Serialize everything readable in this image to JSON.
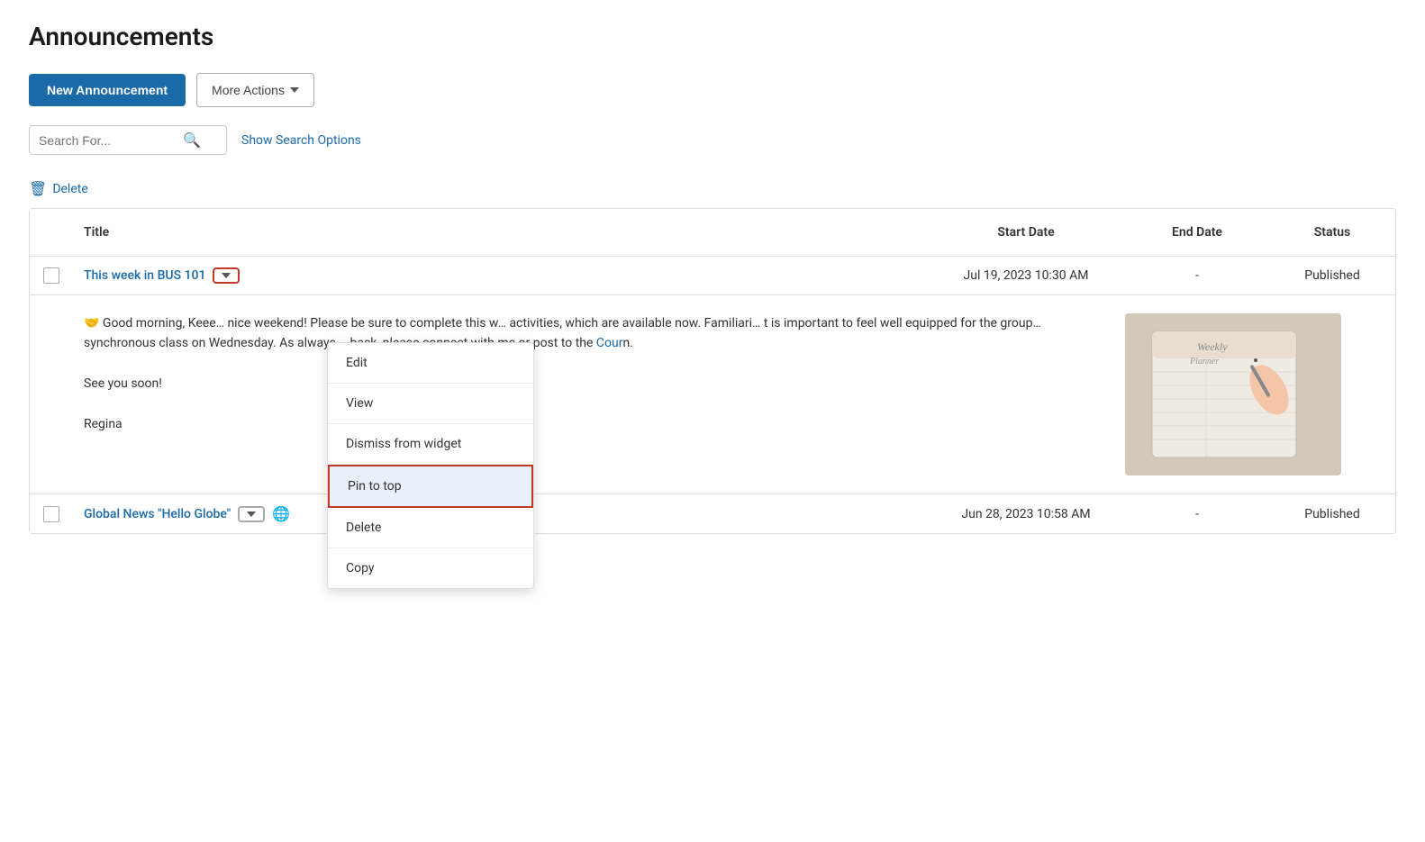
{
  "page": {
    "title": "Announcements"
  },
  "toolbar": {
    "new_announcement_label": "New Announcement",
    "more_actions_label": "More Actions"
  },
  "search": {
    "placeholder": "Search For...",
    "show_options_label": "Show Search Options"
  },
  "actions_row": {
    "delete_label": "Delete"
  },
  "table": {
    "headers": {
      "title": "Title",
      "start_date": "Start Date",
      "end_date": "End Date",
      "status": "Status"
    },
    "rows": [
      {
        "id": "row1",
        "title": "This week in BUS 101",
        "start_date": "Jul 19, 2023 10:30 AM",
        "end_date": "-",
        "status": "Published",
        "has_dropdown": true,
        "preview": {
          "text_part1": "🤝 Good morning, Kee",
          "text_part2": "nice weekend! Please be sure to complete this w",
          "text_part3": " activities, which are available now. Familiari",
          "text_part4": "t is important to feel well equipped for the group",
          "text_part5": " synchronous class on Wednesday. As always,",
          "text_part6": " back, please connect with me or post to the Cour",
          "text_part7": "n.",
          "text_see_you": "See you soon!",
          "text_name": "Regina",
          "blue_link_text": "Cour"
        }
      },
      {
        "id": "row2",
        "title": "Global News \"Hello Globe\"",
        "start_date": "Jun 28, 2023 10:58 AM",
        "end_date": "-",
        "status": "Published",
        "has_dropdown": true,
        "has_globe": true
      }
    ]
  },
  "dropdown_menu": {
    "items": [
      {
        "id": "edit",
        "label": "Edit",
        "highlighted": false
      },
      {
        "id": "view",
        "label": "View",
        "highlighted": false
      },
      {
        "id": "dismiss",
        "label": "Dismiss from widget",
        "highlighted": false
      },
      {
        "id": "pin",
        "label": "Pin to top",
        "highlighted": true
      },
      {
        "id": "delete",
        "label": "Delete",
        "highlighted": false
      },
      {
        "id": "copy",
        "label": "Copy",
        "highlighted": false
      }
    ]
  }
}
